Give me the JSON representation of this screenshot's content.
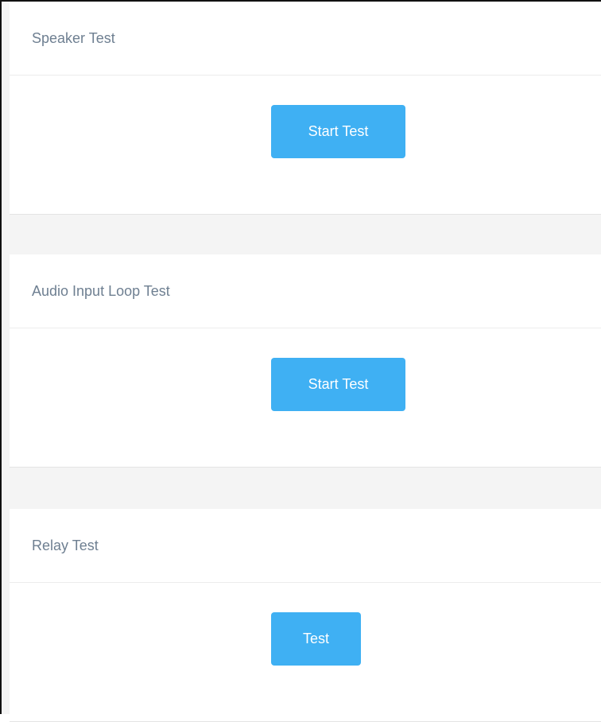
{
  "sections": [
    {
      "title": "Speaker Test",
      "button_label": "Start Test"
    },
    {
      "title": "Audio Input Loop Test",
      "button_label": "Start Test"
    },
    {
      "title": "Relay Test",
      "button_label": "Test"
    }
  ],
  "colors": {
    "button": "#3fb0f3",
    "title_text": "#6e7f91",
    "separator_bg": "#f4f4f4"
  }
}
